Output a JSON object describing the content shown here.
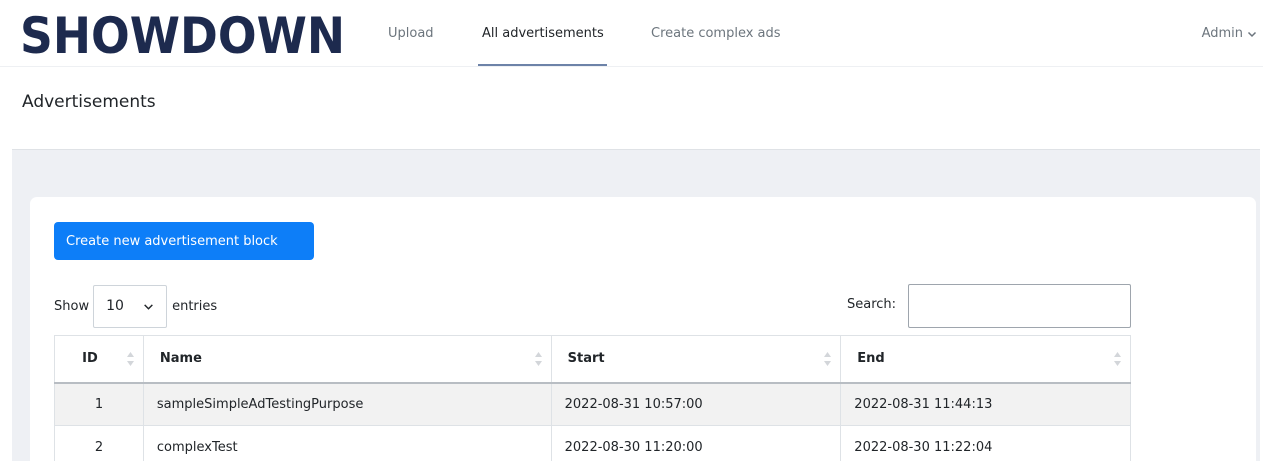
{
  "brand": {
    "logo_text": "SHOWDOWN"
  },
  "nav": {
    "items": [
      {
        "label": "Upload"
      },
      {
        "label": "All advertisements"
      },
      {
        "label": "Create complex ads"
      }
    ],
    "user_label": "Admin"
  },
  "page": {
    "title": "Advertisements"
  },
  "toolbar": {
    "create_label": "Create new advertisement block",
    "show_label": "Show",
    "entries_value": "10",
    "entries_label": "entries",
    "search_label": "Search:",
    "search_value": ""
  },
  "table": {
    "columns": [
      "ID",
      "Name",
      "Start",
      "End"
    ],
    "rows": [
      {
        "id": "1",
        "name": "sampleSimpleAdTestingPurpose",
        "start": "2022-08-31 10:57:00",
        "end": "2022-08-31 11:44:13"
      },
      {
        "id": "2",
        "name": "complexTest",
        "start": "2022-08-30 11:20:00",
        "end": "2022-08-30 11:22:04"
      }
    ]
  },
  "colors": {
    "primary": "#0d7ef8",
    "logo": "#1d2a4e",
    "content_bg": "#eef0f4"
  }
}
